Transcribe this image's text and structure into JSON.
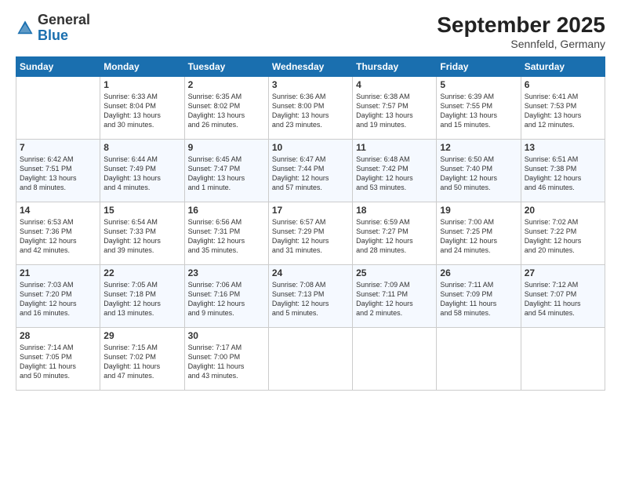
{
  "header": {
    "logo_general": "General",
    "logo_blue": "Blue",
    "month_title": "September 2025",
    "location": "Sennfeld, Germany"
  },
  "days_of_week": [
    "Sunday",
    "Monday",
    "Tuesday",
    "Wednesday",
    "Thursday",
    "Friday",
    "Saturday"
  ],
  "weeks": [
    [
      {
        "day": "",
        "content": ""
      },
      {
        "day": "1",
        "content": "Sunrise: 6:33 AM\nSunset: 8:04 PM\nDaylight: 13 hours\nand 30 minutes."
      },
      {
        "day": "2",
        "content": "Sunrise: 6:35 AM\nSunset: 8:02 PM\nDaylight: 13 hours\nand 26 minutes."
      },
      {
        "day": "3",
        "content": "Sunrise: 6:36 AM\nSunset: 8:00 PM\nDaylight: 13 hours\nand 23 minutes."
      },
      {
        "day": "4",
        "content": "Sunrise: 6:38 AM\nSunset: 7:57 PM\nDaylight: 13 hours\nand 19 minutes."
      },
      {
        "day": "5",
        "content": "Sunrise: 6:39 AM\nSunset: 7:55 PM\nDaylight: 13 hours\nand 15 minutes."
      },
      {
        "day": "6",
        "content": "Sunrise: 6:41 AM\nSunset: 7:53 PM\nDaylight: 13 hours\nand 12 minutes."
      }
    ],
    [
      {
        "day": "7",
        "content": "Sunrise: 6:42 AM\nSunset: 7:51 PM\nDaylight: 13 hours\nand 8 minutes."
      },
      {
        "day": "8",
        "content": "Sunrise: 6:44 AM\nSunset: 7:49 PM\nDaylight: 13 hours\nand 4 minutes."
      },
      {
        "day": "9",
        "content": "Sunrise: 6:45 AM\nSunset: 7:47 PM\nDaylight: 13 hours\nand 1 minute."
      },
      {
        "day": "10",
        "content": "Sunrise: 6:47 AM\nSunset: 7:44 PM\nDaylight: 12 hours\nand 57 minutes."
      },
      {
        "day": "11",
        "content": "Sunrise: 6:48 AM\nSunset: 7:42 PM\nDaylight: 12 hours\nand 53 minutes."
      },
      {
        "day": "12",
        "content": "Sunrise: 6:50 AM\nSunset: 7:40 PM\nDaylight: 12 hours\nand 50 minutes."
      },
      {
        "day": "13",
        "content": "Sunrise: 6:51 AM\nSunset: 7:38 PM\nDaylight: 12 hours\nand 46 minutes."
      }
    ],
    [
      {
        "day": "14",
        "content": "Sunrise: 6:53 AM\nSunset: 7:36 PM\nDaylight: 12 hours\nand 42 minutes."
      },
      {
        "day": "15",
        "content": "Sunrise: 6:54 AM\nSunset: 7:33 PM\nDaylight: 12 hours\nand 39 minutes."
      },
      {
        "day": "16",
        "content": "Sunrise: 6:56 AM\nSunset: 7:31 PM\nDaylight: 12 hours\nand 35 minutes."
      },
      {
        "day": "17",
        "content": "Sunrise: 6:57 AM\nSunset: 7:29 PM\nDaylight: 12 hours\nand 31 minutes."
      },
      {
        "day": "18",
        "content": "Sunrise: 6:59 AM\nSunset: 7:27 PM\nDaylight: 12 hours\nand 28 minutes."
      },
      {
        "day": "19",
        "content": "Sunrise: 7:00 AM\nSunset: 7:25 PM\nDaylight: 12 hours\nand 24 minutes."
      },
      {
        "day": "20",
        "content": "Sunrise: 7:02 AM\nSunset: 7:22 PM\nDaylight: 12 hours\nand 20 minutes."
      }
    ],
    [
      {
        "day": "21",
        "content": "Sunrise: 7:03 AM\nSunset: 7:20 PM\nDaylight: 12 hours\nand 16 minutes."
      },
      {
        "day": "22",
        "content": "Sunrise: 7:05 AM\nSunset: 7:18 PM\nDaylight: 12 hours\nand 13 minutes."
      },
      {
        "day": "23",
        "content": "Sunrise: 7:06 AM\nSunset: 7:16 PM\nDaylight: 12 hours\nand 9 minutes."
      },
      {
        "day": "24",
        "content": "Sunrise: 7:08 AM\nSunset: 7:13 PM\nDaylight: 12 hours\nand 5 minutes."
      },
      {
        "day": "25",
        "content": "Sunrise: 7:09 AM\nSunset: 7:11 PM\nDaylight: 12 hours\nand 2 minutes."
      },
      {
        "day": "26",
        "content": "Sunrise: 7:11 AM\nSunset: 7:09 PM\nDaylight: 11 hours\nand 58 minutes."
      },
      {
        "day": "27",
        "content": "Sunrise: 7:12 AM\nSunset: 7:07 PM\nDaylight: 11 hours\nand 54 minutes."
      }
    ],
    [
      {
        "day": "28",
        "content": "Sunrise: 7:14 AM\nSunset: 7:05 PM\nDaylight: 11 hours\nand 50 minutes."
      },
      {
        "day": "29",
        "content": "Sunrise: 7:15 AM\nSunset: 7:02 PM\nDaylight: 11 hours\nand 47 minutes."
      },
      {
        "day": "30",
        "content": "Sunrise: 7:17 AM\nSunset: 7:00 PM\nDaylight: 11 hours\nand 43 minutes."
      },
      {
        "day": "",
        "content": ""
      },
      {
        "day": "",
        "content": ""
      },
      {
        "day": "",
        "content": ""
      },
      {
        "day": "",
        "content": ""
      }
    ]
  ]
}
